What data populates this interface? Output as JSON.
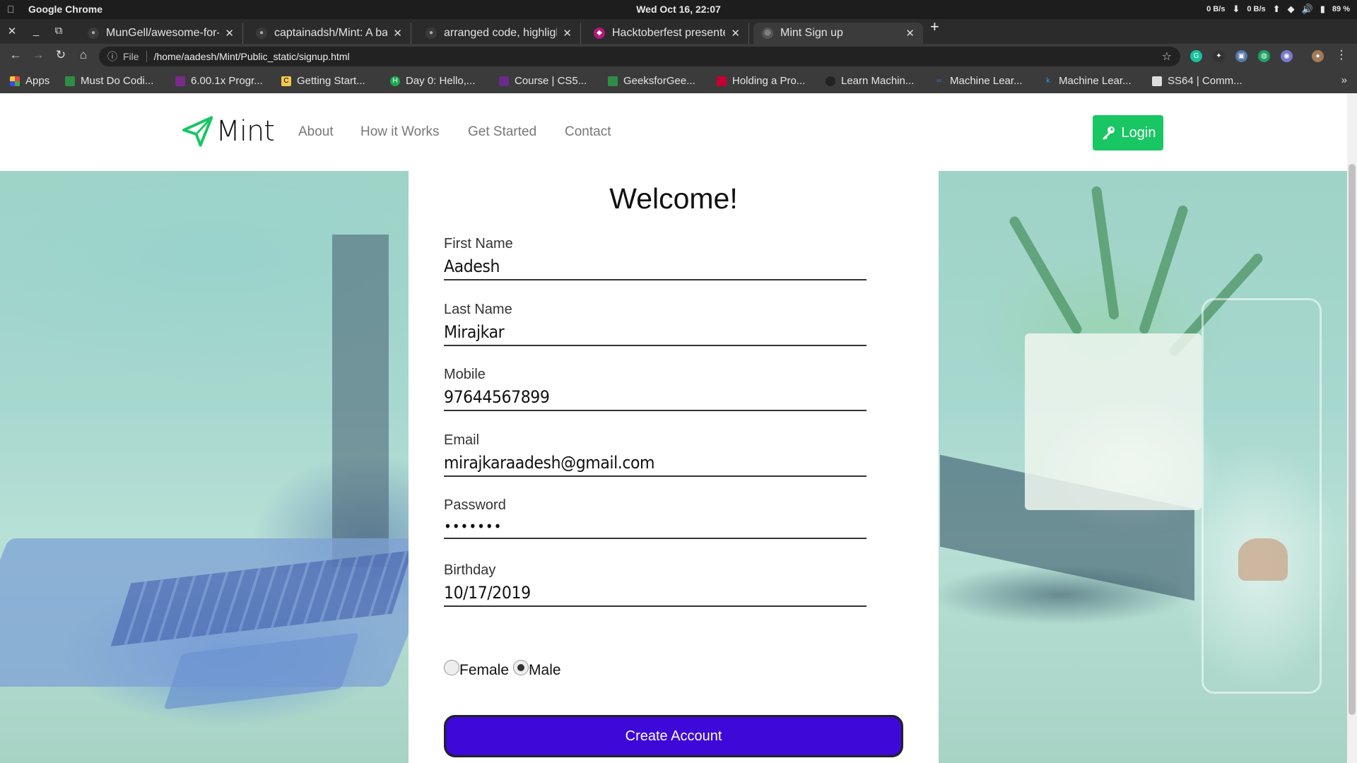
{
  "os": {
    "app_name": "Google Chrome",
    "clock": "Wed Oct 16, 22:07",
    "net_down": "0 B/s",
    "net_up": "0 B/s",
    "battery": "89 %"
  },
  "tabs": [
    {
      "title": "MunGell/awesome-for-b"
    },
    {
      "title": "captainadsh/Mint: A bar"
    },
    {
      "title": "arranged code, highlight"
    },
    {
      "title": "Hacktoberfest presente"
    },
    {
      "title": "Mint Sign up"
    }
  ],
  "address": {
    "scheme": "File",
    "url": "/home/aadesh/Mint/Public_static/signup.html"
  },
  "bookmarks": [
    {
      "label": "Apps"
    },
    {
      "label": "Must Do Codi..."
    },
    {
      "label": "6.00.1x Progr..."
    },
    {
      "label": "Getting Start..."
    },
    {
      "label": "Day 0: Hello,..."
    },
    {
      "label": "Course | CS5..."
    },
    {
      "label": "GeeksforGee..."
    },
    {
      "label": "Holding a Pro..."
    },
    {
      "label": "Learn Machin..."
    },
    {
      "label": "Machine Lear..."
    },
    {
      "label": "Machine Lear..."
    },
    {
      "label": "SS64 | Comm..."
    }
  ],
  "navbar": {
    "logo_text": "Mint",
    "links": [
      "About",
      "How it Works",
      "Get Started",
      "Contact"
    ],
    "login_label": "Login"
  },
  "form": {
    "heading": "Welcome!",
    "first_name": {
      "label": "First Name",
      "value": "Aadesh"
    },
    "last_name": {
      "label": "Last Name",
      "value": "Mirajkar"
    },
    "mobile": {
      "label": "Mobile",
      "value": "97644567899"
    },
    "email": {
      "label": "Email",
      "value": "mirajkaraadesh@gmail.com"
    },
    "password": {
      "label": "Password",
      "value": "•••••••"
    },
    "birthday": {
      "label": "Birthday",
      "value": "10/17/2019"
    },
    "gender": {
      "options": [
        "Female",
        "Male"
      ],
      "selected": "Male"
    },
    "submit_label": "Create Account"
  },
  "colors": {
    "brand_green": "#18c663",
    "submit_purple": "#3d08d8"
  }
}
